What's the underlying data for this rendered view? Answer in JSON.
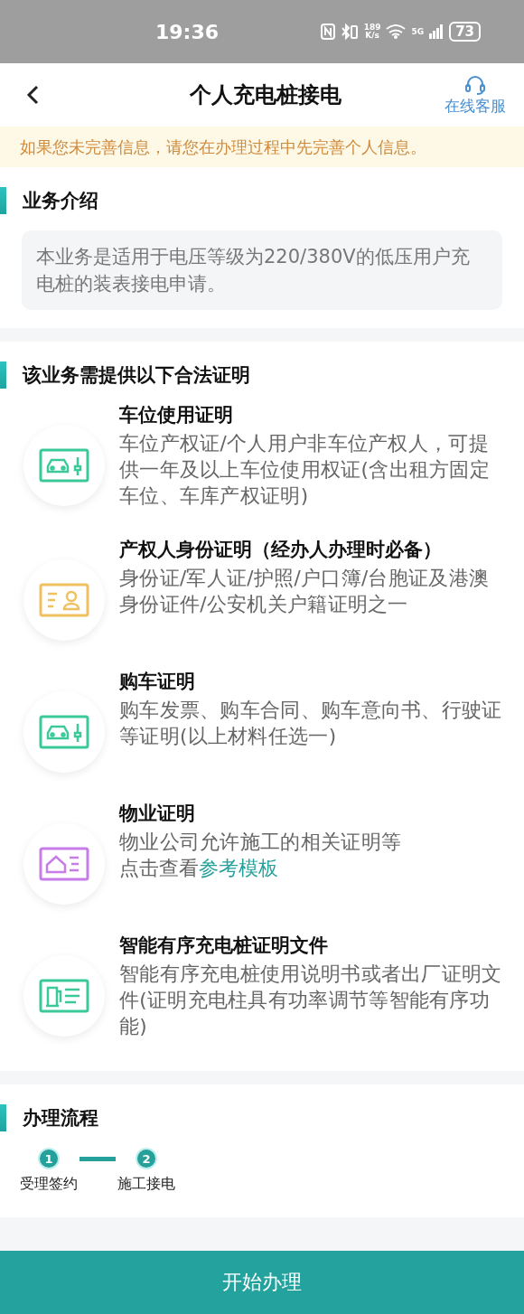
{
  "status_bar": {
    "time": "19:36",
    "speed": "189",
    "speed_unit": "K/s",
    "network": "5G",
    "battery": "73"
  },
  "nav": {
    "title": "个人充电桩接电",
    "service": "在线客服"
  },
  "notice": "如果您未完善信息，请您在办理过程中先完善个人信息。",
  "intro": {
    "title": "业务介绍",
    "text": "本业务是适用于电压等级为220/380V的低压用户充电桩的装表接电申请。"
  },
  "documents": {
    "title": "该业务需提供以下合法证明",
    "items": [
      {
        "kind": "car",
        "color": "#3cc99a",
        "title": "车位使用证明",
        "description": "车位产权证/个人用户非车位产权人，可提供一年及以上车位使用权证(含出租方固定车位、车库产权证明)"
      },
      {
        "kind": "id",
        "color": "#f0c060",
        "title": "产权人身份证明（经办人办理时必备）",
        "description": "身份证/军人证/护照/户口簿/台胞证及港澳身份证件/公安机关户籍证明之一"
      },
      {
        "kind": "car",
        "color": "#3cc99a",
        "title": "购车证明",
        "description": "购车发票、购车合同、购车意向书、行驶证等证明(以上材料任选一)"
      },
      {
        "kind": "house",
        "color": "#c77de8",
        "title": "物业证明",
        "description": "物业公司允许施工的相关证明等",
        "link_prefix": "点击查看",
        "link": "参考模板"
      },
      {
        "kind": "charger",
        "color": "#3cc99a",
        "title": "智能有序充电桩证明文件",
        "description": "智能有序充电桩使用说明书或者出厂证明文件(证明充电柱具有功率调节等智能有序功能)"
      }
    ]
  },
  "process": {
    "title": "办理流程",
    "steps": [
      {
        "number": "1",
        "label": "受理签约"
      },
      {
        "number": "2",
        "label": "施工接电"
      }
    ]
  },
  "start_button": "开始办理"
}
